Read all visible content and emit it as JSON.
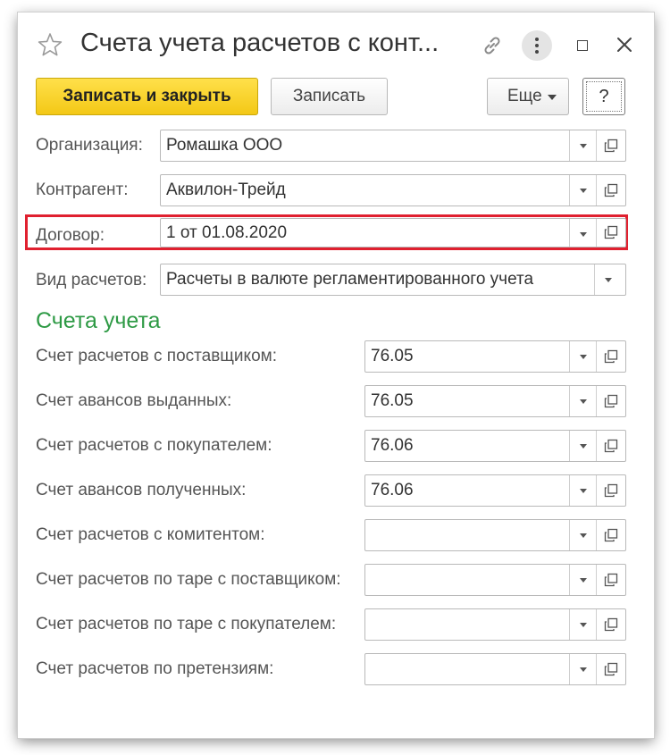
{
  "window": {
    "title": "Счета учета расчетов с конт..."
  },
  "toolbar": {
    "save_close_label": "Записать и закрыть",
    "save_label": "Записать",
    "more_label": "Еще",
    "help_label": "?"
  },
  "fields": {
    "organization": {
      "label": "Организация:",
      "value": "Ромашка ООО"
    },
    "counterparty": {
      "label": "Контрагент:",
      "value": "Аквилон-Трейд"
    },
    "contract": {
      "label": "Договор:",
      "value": "1 от 01.08.2020"
    },
    "settlement_type": {
      "label": "Вид расчетов:",
      "value": "Расчеты в валюте регламентированного учета"
    }
  },
  "accounts": {
    "section_title": "Счета учета",
    "rows": [
      {
        "label": "Счет расчетов с поставщиком:",
        "value": "76.05"
      },
      {
        "label": "Счет авансов выданных:",
        "value": "76.05"
      },
      {
        "label": "Счет расчетов с покупателем:",
        "value": "76.06"
      },
      {
        "label": "Счет авансов полученных:",
        "value": "76.06"
      },
      {
        "label": "Счет расчетов с комитентом:",
        "value": ""
      },
      {
        "label": "Счет расчетов по таре с поставщиком:",
        "value": ""
      },
      {
        "label": "Счет расчетов по таре с покупателем:",
        "value": ""
      },
      {
        "label": "Счет расчетов по претензиям:",
        "value": ""
      }
    ]
  },
  "colors": {
    "primary_button": "#f3c816",
    "section_title": "#2e9a45",
    "highlight_border": "#e0202f"
  }
}
